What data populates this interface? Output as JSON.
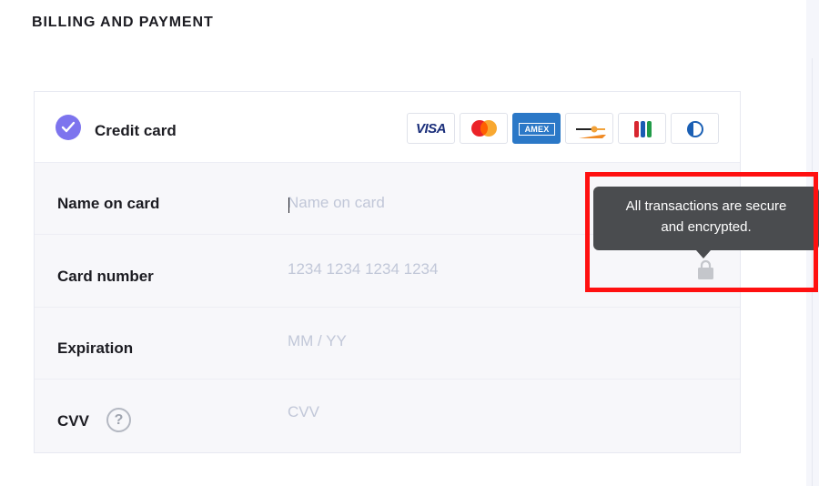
{
  "section": {
    "title": "BILLING AND PAYMENT"
  },
  "payment_method": {
    "label": "Credit card",
    "selected": true,
    "brands": [
      {
        "name": "VISA",
        "icon": "visa-logo-icon"
      },
      {
        "name": "Mastercard",
        "icon": "mastercard-logo-icon"
      },
      {
        "name": "AMEX",
        "icon": "amex-logo-icon"
      },
      {
        "name": "Diners",
        "icon": "diners-logo-icon"
      },
      {
        "name": "JCB",
        "icon": "jcb-logo-icon"
      },
      {
        "name": "Diners Club",
        "icon": "diners-club-logo-icon"
      }
    ]
  },
  "fields": {
    "name": {
      "label": "Name on card",
      "placeholder": "Name on card",
      "value": ""
    },
    "number": {
      "label": "Card number",
      "placeholder": "1234 1234 1234 1234",
      "value": ""
    },
    "expiration": {
      "label": "Expiration",
      "placeholder": "MM / YY",
      "value": ""
    },
    "cvv": {
      "label": "CVV",
      "placeholder": "CVV",
      "value": "",
      "help_glyph": "?"
    }
  },
  "tooltip": {
    "line1": "All transactions are secure",
    "line2": "and encrypted."
  },
  "colors": {
    "accent": "#7d74ee",
    "tooltip_bg": "#4a4c4f",
    "highlight": "#ff1010",
    "amex_blue": "#2b78c7"
  },
  "icons": {
    "check": "check-icon",
    "lock": "lock-icon",
    "help": "question-circle-icon"
  }
}
